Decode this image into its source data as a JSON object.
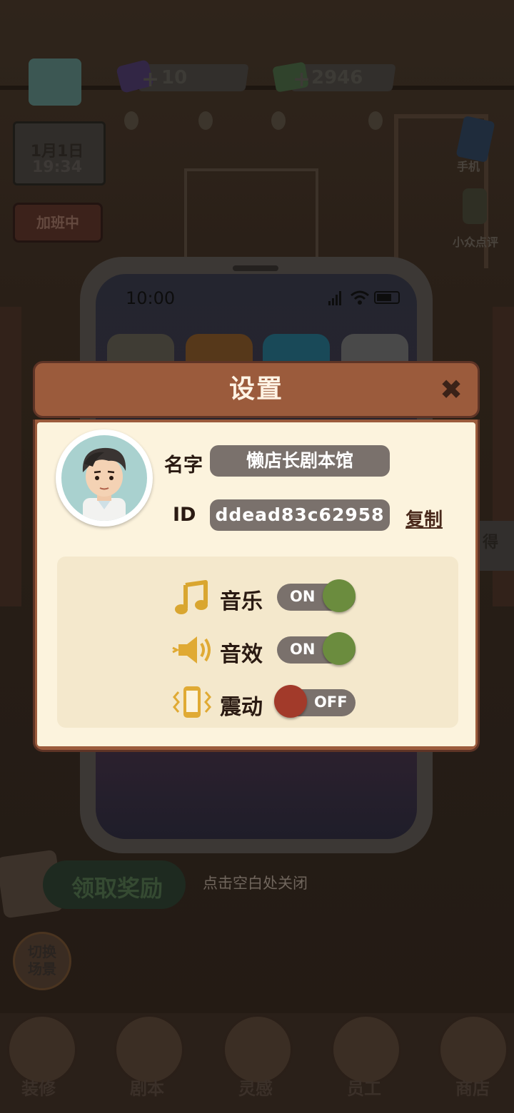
{
  "hud": {
    "gem_count": "10",
    "cash_count": "2946",
    "date": "1月1日",
    "time": "19:34",
    "overtime_label": "加班中",
    "phone_label": "手机",
    "review_label": "小众点评",
    "side_tag": "得",
    "switch_scene_label": "切换\n场景"
  },
  "phone": {
    "status_time": "10:00"
  },
  "dialog": {
    "title": "设置",
    "close_symbol": "✖",
    "name_label": "名字",
    "name_value": "懒店长剧本馆",
    "id_label": "ID",
    "id_value": "ddead83c62958",
    "copy_label": "复制",
    "settings": [
      {
        "label": "音乐",
        "state": "ON",
        "on": true
      },
      {
        "label": "音效",
        "state": "ON",
        "on": true
      },
      {
        "label": "震动",
        "state": "OFF",
        "on": false
      }
    ]
  },
  "reward_label": "领取奖励",
  "close_hint": "点击空白处关闭",
  "nav": [
    {
      "label": "装修"
    },
    {
      "label": "剧本"
    },
    {
      "label": "灵感"
    },
    {
      "label": "员工"
    },
    {
      "label": "商店"
    }
  ],
  "colors": {
    "header_brown": "#9b5b3c",
    "paper": "#fcf3dd",
    "toggle_on_knob": "#6b8c3e",
    "toggle_off_knob": "#a23a2a",
    "pill_gray": "#7a716c"
  }
}
